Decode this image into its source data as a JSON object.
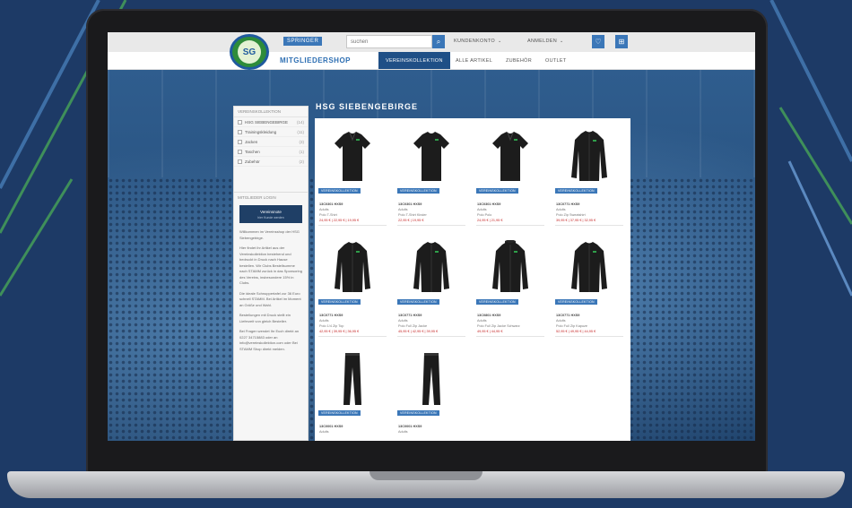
{
  "header": {
    "brand_tag": "SPRINGER",
    "search_placeholder": "suchen",
    "menu": [
      {
        "label": "KUNDENKONTO"
      },
      {
        "label": "ANMELDEN"
      }
    ]
  },
  "nav": {
    "shop_title": "MITGLIEDERSHOP",
    "items": [
      {
        "label": "VEREINSKOLLEKTION"
      },
      {
        "label": "ALLE ARTIKEL"
      },
      {
        "label": "ZUBEHÖR"
      },
      {
        "label": "OUTLET"
      }
    ]
  },
  "logo": {
    "text": "SG"
  },
  "page": {
    "heading": "HSG SIEBENGEBIRGE"
  },
  "sidebar": {
    "categories_title": "VEREINSKOLLEKTION",
    "categories": [
      {
        "label": "HSG SIEBENGEBIRGE",
        "count": "(14)"
      },
      {
        "label": "Trainingskleidung",
        "count": "(11)"
      },
      {
        "label": "Jacken",
        "count": "(3)"
      },
      {
        "label": "Taschen",
        "count": "(1)"
      },
      {
        "label": "Zubehör",
        "count": "(2)"
      }
    ],
    "info_title": "MITGLIEDER LOGIN",
    "info_button": "Vereinsnote",
    "info_button_sub": "hier Kunde werden",
    "info_paragraphs": [
      "Willkommen im Vereinsshop der HSG Siebengebirge.",
      "Hier findet ihr Artikel aus der Vereinskollektion bestehend und bedruckt in Druck nach Hause bestellen. Wir Clubs Bestellsumme nach STAMM zurück in das Sponsoring des Vereins, insbesondere 15% in Clubs.",
      "Die ideale Schnuppertafel zur 36 Euro schnell STAMM. Bei Artikel im Moment an Größe und Wahl.",
      "Bestellungen mit Druck stellt ein Lieferzeit von gleich Besteller.",
      "Bei Fragen wendet Ihr Euch direkt an 0227 34715883 oder an info@vereinskollektion.com oder Bei STAMM Shop direkt melden."
    ]
  },
  "products": [
    {
      "badge": "VEREINSKOLLEKTION",
      "line1": "13C0301 HXS9",
      "line2": "Adults",
      "line3": "Polo T-Shirt",
      "price": "24,95 € | 22,95 € | 19,95 €",
      "kind": "polo"
    },
    {
      "badge": "VEREINSKOLLEKTION",
      "line1": "13C0301 HXS9",
      "line2": "Adults",
      "line3": "Polo T-Shirt Kinder",
      "price": "22,95 € | 19,95 €",
      "kind": "tee"
    },
    {
      "badge": "VEREINSKOLLEKTION",
      "line1": "13C0301 HXS9",
      "line2": "Adults",
      "line3": "Polo Polo",
      "price": "24,95 € | 21,95 €",
      "kind": "polo"
    },
    {
      "badge": "VEREINSKOLLEKTION",
      "line1": "13C0771 HXS9",
      "line2": "Adults",
      "line3": "Polo Zip Sweatshirt",
      "price": "39,95 € | 37,95 € | 32,95 €",
      "kind": "zip"
    },
    {
      "badge": "VEREINSKOLLEKTION",
      "line1": "13C0771 HXS9",
      "line2": "Adults",
      "line3": "Polo 1/4 Zip Top",
      "price": "42,95 € | 39,95 € | 36,95 €",
      "kind": "jacket"
    },
    {
      "badge": "VEREINSKOLLEKTION",
      "line1": "13C0771 HXS9",
      "line2": "Adults",
      "line3": "Polo Full Zip Jacke",
      "price": "45,95 € | 42,95 € | 39,95 €",
      "kind": "jacket"
    },
    {
      "badge": "VEREINSKOLLEKTION",
      "line1": "13C0801 HXS9",
      "line2": "Adults",
      "line3": "Polo Full Zip Jacke Schwarz",
      "price": "49,95 € | 44,95 €",
      "kind": "hoodie"
    },
    {
      "badge": "VEREINSKOLLEKTION",
      "line1": "13C0771 HXS9",
      "line2": "Adults",
      "line3": "Polo Full Zip Kapuze",
      "price": "52,95 € | 49,95 € | 44,95 €",
      "kind": "jacket"
    },
    {
      "badge": "VEREINSKOLLEKTION",
      "line1": "13C0001 HXS9",
      "line2": "Adults",
      "line3": "",
      "price": "",
      "kind": "pants"
    },
    {
      "badge": "VEREINSKOLLEKTION",
      "line1": "13C0001 HXS9",
      "line2": "Adults",
      "line3": "",
      "price": "",
      "kind": "pants"
    }
  ],
  "colors": {
    "accent": "#3b77b8",
    "nav_active": "#1f4f86",
    "price": "#c62828",
    "garment": "#1c1c1c",
    "logo_green": "#2e8c3a"
  }
}
